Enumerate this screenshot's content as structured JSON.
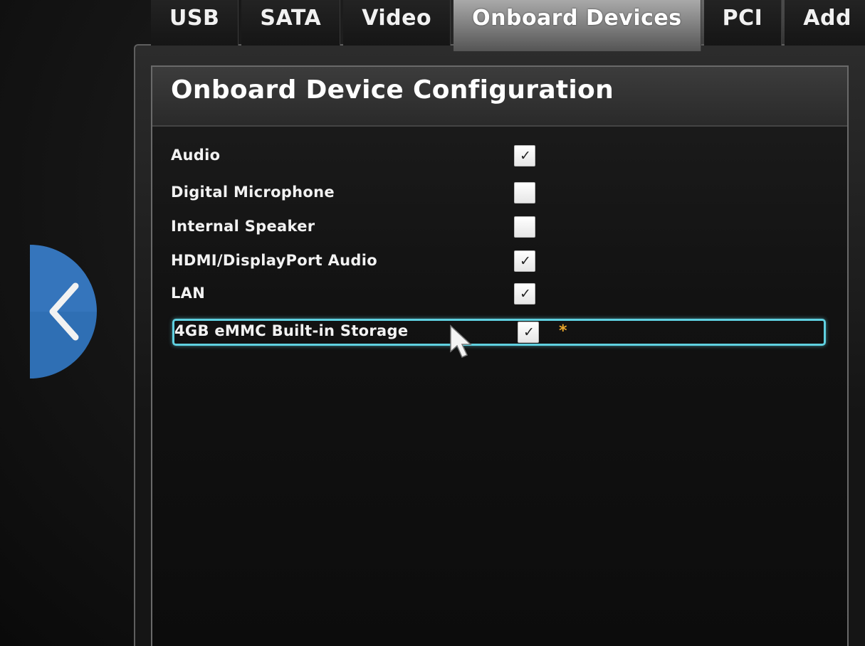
{
  "tabs": [
    {
      "label": "USB",
      "active": false
    },
    {
      "label": "SATA",
      "active": false
    },
    {
      "label": "Video",
      "active": false
    },
    {
      "label": "Onboard Devices",
      "active": true
    },
    {
      "label": "PCI",
      "active": false
    },
    {
      "label": "Add",
      "active": false
    }
  ],
  "panel": {
    "title": "Onboard Device Configuration"
  },
  "settings": [
    {
      "label": "Audio",
      "checked": true
    },
    {
      "label": "Digital Microphone",
      "checked": false
    },
    {
      "label": "Internal Speaker",
      "checked": false
    },
    {
      "label": "HDMI/DisplayPort Audio",
      "checked": true
    },
    {
      "label": "LAN",
      "checked": true
    },
    {
      "label": "4GB eMMC Built-in Storage",
      "checked": true,
      "selected": true,
      "modified_marker": "*"
    }
  ],
  "icons": {
    "back": "chevron-left-icon",
    "check": "checkmark-icon",
    "cursor": "mouse-pointer-icon"
  },
  "colors": {
    "selection_outline": "#5fd0e0",
    "back_button": "#2f6fb4",
    "modified_marker": "#e8a52a",
    "active_tab": "#8a8a8a"
  }
}
